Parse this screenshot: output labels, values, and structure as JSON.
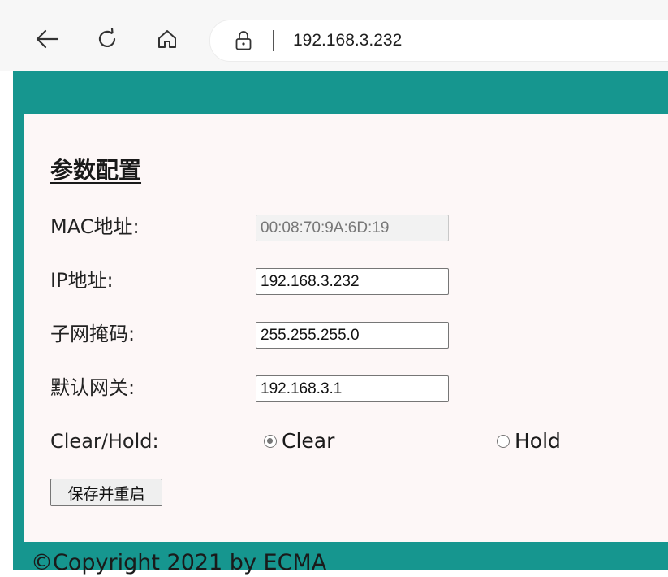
{
  "browser": {
    "url": "192.168.3.232",
    "icons": [
      "back-arrow-icon",
      "reload-icon",
      "home-icon",
      "lock-icon"
    ]
  },
  "form": {
    "title": "参数配置",
    "mac_label": "MAC地址:",
    "mac_value": "00:08:70:9A:6D:19",
    "ip_label": "IP地址:",
    "ip_value": "192.168.3.232",
    "mask_label": "子网掩码:",
    "mask_value": "255.255.255.0",
    "gateway_label": "默认网关:",
    "gateway_value": "192.168.3.1",
    "mode_label": "Clear/Hold:",
    "mode_options": [
      "Clear",
      "Hold"
    ],
    "mode_selected": "Clear",
    "submit_label": "保存并重启"
  },
  "footer": {
    "text": "©Copyright 2021 by ECMA"
  },
  "colors": {
    "frame": "#16968f",
    "content_bg": "#fdf7f7",
    "chrome_bg": "#f7f7f7"
  }
}
